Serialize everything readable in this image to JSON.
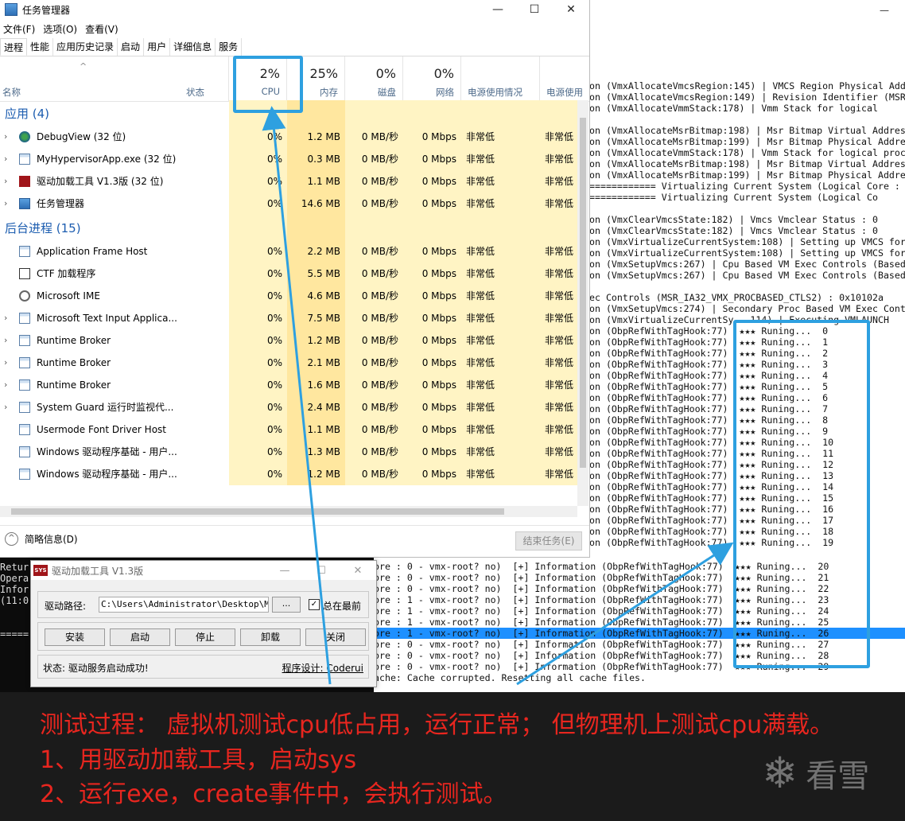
{
  "debug_window": {
    "controls": [
      "—",
      "□",
      "✕"
    ],
    "lines": [
      {
        "text": "on (VmxAllocateVmcsRegion:145) | VMCS Region Physical Add",
        "selected": false
      },
      {
        "text": "on (VmxAllocateVmcsRegion:149) | Revision Identifier (MSR",
        "selected": false
      },
      {
        "text": "on (VmxAllocateVmmStack:178) | Vmm Stack for logical",
        "selected": false
      },
      {
        "text": "",
        "selected": false
      },
      {
        "text": "on (VmxAllocateMsrBitmap:198) | Msr Bitmap Virtual Addres",
        "selected": false
      },
      {
        "text": "on (VmxAllocateMsrBitmap:199) | Msr Bitmap Physical Addre",
        "selected": false
      },
      {
        "text": "on (VmxAllocateVmmStack:178) | Vmm Stack for logical proc",
        "selected": false
      },
      {
        "text": "on (VmxAllocateMsrBitmap:198) | Msr Bitmap Virtual Addres",
        "selected": false
      },
      {
        "text": "on (VmxAllocateMsrBitmap:199) | Msr Bitmap Physical Addre",
        "selected": false
      },
      {
        "text": "============ Virtualizing Current System (Logical Core : 0",
        "selected": false
      },
      {
        "text": "============ Virtualizing Current System (Logical Co",
        "selected": false
      },
      {
        "text": "",
        "selected": false
      },
      {
        "text": "on (VmxClearVmcsState:182) | Vmcs Vmclear Status : 0",
        "selected": false
      },
      {
        "text": "on (VmxClearVmcsState:182) | Vmcs Vmclear Status : 0",
        "selected": false
      },
      {
        "text": "on (VmxVirtualizeCurrentSystem:108) | Setting up VMCS for",
        "selected": false
      },
      {
        "text": "on (VmxVirtualizeCurrentSystem:108) | Setting up VMCS for",
        "selected": false
      },
      {
        "text": "on (VmxSetupVmcs:267) | Cpu Based VM Exec Controls (Based",
        "selected": false
      },
      {
        "text": "on (VmxSetupVmcs:267) | Cpu Based VM Exec Controls (Based",
        "selected": false
      },
      {
        "text": "",
        "selected": false
      },
      {
        "text": "ec Controls (MSR_IA32_VMX_PROCBASED_CTLS2) : 0x10102a",
        "selected": false
      },
      {
        "text": "on (VmxSetupVmcs:274) | Secondary Proc Based VM Exec Cont",
        "selected": false
      },
      {
        "text": "on (VmxVirtualizeCurrentSy...114) | Executing VMLAUNCH",
        "selected": false
      },
      {
        "text": "on (ObpRefWithTagHook:77)  ★★★ Runing...  0",
        "selected": false
      },
      {
        "text": "on (ObpRefWithTagHook:77)  ★★★ Runing...  1",
        "selected": false
      },
      {
        "text": "on (ObpRefWithTagHook:77)  ★★★ Runing...  2",
        "selected": false
      },
      {
        "text": "on (ObpRefWithTagHook:77)  ★★★ Runing...  3",
        "selected": false
      },
      {
        "text": "on (ObpRefWithTagHook:77)  ★★★ Runing...  4",
        "selected": false
      },
      {
        "text": "on (ObpRefWithTagHook:77)  ★★★ Runing...  5",
        "selected": false
      },
      {
        "text": "on (ObpRefWithTagHook:77)  ★★★ Runing...  6",
        "selected": false
      },
      {
        "text": "on (ObpRefWithTagHook:77)  ★★★ Runing...  7",
        "selected": false
      },
      {
        "text": "on (ObpRefWithTagHook:77)  ★★★ Runing...  8",
        "selected": false
      },
      {
        "text": "on (ObpRefWithTagHook:77)  ★★★ Runing...  9",
        "selected": false
      },
      {
        "text": "on (ObpRefWithTagHook:77)  ★★★ Runing...  10",
        "selected": false
      },
      {
        "text": "on (ObpRefWithTagHook:77)  ★★★ Runing...  11",
        "selected": false
      },
      {
        "text": "on (ObpRefWithTagHook:77)  ★★★ Runing...  12",
        "selected": false
      },
      {
        "text": "on (ObpRefWithTagHook:77)  ★★★ Runing...  13",
        "selected": false
      },
      {
        "text": "on (ObpRefWithTagHook:77)  ★★★ Runing...  14",
        "selected": false
      },
      {
        "text": "on (ObpRefWithTagHook:77)  ★★★ Runing...  15",
        "selected": false
      },
      {
        "text": "on (ObpRefWithTagHook:77)  ★★★ Runing...  16",
        "selected": false
      },
      {
        "text": "on (ObpRefWithTagHook:77)  ★★★ Runing...  17",
        "selected": false
      },
      {
        "text": "on (ObpRefWithTagHook:77)  ★★★ Runing...  18",
        "selected": false
      },
      {
        "text": "on (ObpRefWithTagHook:77)  ★★★ Runing...  19",
        "selected": false
      }
    ]
  },
  "console": {
    "left_lines": [
      "Retur",
      "Opera",
      "Infor",
      "(11:0",
      "",
      "",
      "====="
    ],
    "right_lines": [
      {
        "text": "ore : 0 - vmx-root? no)  [+] Information (ObpRefWithTagHook:77)  ★★★ Runing...  20",
        "selected": false
      },
      {
        "text": "ore : 0 - vmx-root? no)  [+] Information (ObpRefWithTagHook:77)  ★★★ Runing...  21",
        "selected": false
      },
      {
        "text": "ore : 0 - vmx-root? no)  [+] Information (ObpRefWithTagHook:77)  ★★★ Runing...  22",
        "selected": false
      },
      {
        "text": "ore : 1 - vmx-root? no)  [+] Information (ObpRefWithTagHook:77)  ★★★ Runing...  23",
        "selected": false
      },
      {
        "text": "ore : 1 - vmx-root? no)  [+] Information (ObpRefWithTagHook:77)  ★★★ Runing...  24",
        "selected": false
      },
      {
        "text": "ore : 1 - vmx-root? no)  [+] Information (ObpRefWithTagHook:77)  ★★★ Runing...  25",
        "selected": false
      },
      {
        "text": "ore : 1 - vmx-root? no)  [+] Information (ObpRefWithTagHook:77)  ★★★ Runing...  26",
        "selected": true
      },
      {
        "text": "ore : 0 - vmx-root? no)  [+] Information (ObpRefWithTagHook:77)  ★★★ Runing...  27",
        "selected": false
      },
      {
        "text": "ore : 0 - vmx-root? no)  [+] Information (ObpRefWithTagHook:77)  ★★★ Runing...  28",
        "selected": false
      },
      {
        "text": "ore : 0 - vmx-root? no)  [+] Information (ObpRefWithTagHook:77)  ★★★ Runing...  29",
        "selected": false
      },
      {
        "text": "ache: Cache corrupted. Resetting all cache files.",
        "selected": false
      }
    ]
  },
  "taskmgr": {
    "title": "任务管理器",
    "menu": [
      "文件(F)",
      "选项(O)",
      "查看(V)"
    ],
    "tabs": [
      "进程",
      "性能",
      "应用历史记录",
      "启动",
      "用户",
      "详细信息",
      "服务"
    ],
    "active_tab": "进程",
    "columns": {
      "name": "名称",
      "status": "状态",
      "cpu": {
        "pct": "2%",
        "label": "CPU"
      },
      "mem": {
        "pct": "25%",
        "label": "内存"
      },
      "disk": {
        "pct": "0%",
        "label": "磁盘"
      },
      "net": {
        "pct": "0%",
        "label": "网络"
      },
      "power": "电源使用情况",
      "power_trend": "电源使用"
    },
    "groups": [
      {
        "title": "应用 (4)",
        "rows": [
          {
            "name": "DebugView (32 位)",
            "cpu": "0%",
            "mem": "1.2 MB",
            "disk": "0 MB/秒",
            "net": "0 Mbps",
            "power": "非常低",
            "pt": "非常低",
            "expand": true,
            "icon": "debugview-icon"
          },
          {
            "name": "MyHypervisorApp.exe (32 位)",
            "cpu": "0%",
            "mem": "0.3 MB",
            "disk": "0 MB/秒",
            "net": "0 Mbps",
            "power": "非常低",
            "pt": "非常低",
            "expand": true,
            "icon": "app-window-icon"
          },
          {
            "name": "驱动加载工具 V1.3版 (32 位)",
            "cpu": "0%",
            "mem": "1.1 MB",
            "disk": "0 MB/秒",
            "net": "0 Mbps",
            "power": "非常低",
            "pt": "非常低",
            "expand": true,
            "icon": "sys-icon"
          },
          {
            "name": "任务管理器",
            "cpu": "0%",
            "mem": "14.6 MB",
            "disk": "0 MB/秒",
            "net": "0 Mbps",
            "power": "非常低",
            "pt": "非常低",
            "expand": true,
            "icon": "taskmgr-icon"
          }
        ]
      },
      {
        "title": "后台进程 (15)",
        "rows": [
          {
            "name": "Application Frame Host",
            "cpu": "0%",
            "mem": "2.2 MB",
            "disk": "0 MB/秒",
            "net": "0 Mbps",
            "power": "非常低",
            "pt": "非常低",
            "expand": false,
            "icon": "app-window-icon"
          },
          {
            "name": "CTF 加载程序",
            "cpu": "0%",
            "mem": "5.5 MB",
            "disk": "0 MB/秒",
            "net": "0 Mbps",
            "power": "非常低",
            "pt": "非常低",
            "expand": false,
            "icon": "ctf-icon"
          },
          {
            "name": "Microsoft IME",
            "cpu": "0%",
            "mem": "4.6 MB",
            "disk": "0 MB/秒",
            "net": "0 Mbps",
            "power": "非常低",
            "pt": "非常低",
            "expand": false,
            "icon": "gear-icon"
          },
          {
            "name": "Microsoft Text Input Applica...",
            "cpu": "0%",
            "mem": "7.5 MB",
            "disk": "0 MB/秒",
            "net": "0 Mbps",
            "power": "非常低",
            "pt": "非常低",
            "expand": true,
            "icon": "app-window-icon"
          },
          {
            "name": "Runtime Broker",
            "cpu": "0%",
            "mem": "1.2 MB",
            "disk": "0 MB/秒",
            "net": "0 Mbps",
            "power": "非常低",
            "pt": "非常低",
            "expand": true,
            "icon": "app-window-icon"
          },
          {
            "name": "Runtime Broker",
            "cpu": "0%",
            "mem": "2.1 MB",
            "disk": "0 MB/秒",
            "net": "0 Mbps",
            "power": "非常低",
            "pt": "非常低",
            "expand": true,
            "icon": "app-window-icon"
          },
          {
            "name": "Runtime Broker",
            "cpu": "0%",
            "mem": "1.6 MB",
            "disk": "0 MB/秒",
            "net": "0 Mbps",
            "power": "非常低",
            "pt": "非常低",
            "expand": true,
            "icon": "app-window-icon"
          },
          {
            "name": "System Guard 运行时监视代...",
            "cpu": "0%",
            "mem": "2.4 MB",
            "disk": "0 MB/秒",
            "net": "0 Mbps",
            "power": "非常低",
            "pt": "非常低",
            "expand": true,
            "icon": "app-window-icon"
          },
          {
            "name": "Usermode Font Driver Host",
            "cpu": "0%",
            "mem": "1.1 MB",
            "disk": "0 MB/秒",
            "net": "0 Mbps",
            "power": "非常低",
            "pt": "非常低",
            "expand": false,
            "icon": "app-window-icon"
          },
          {
            "name": "Windows 驱动程序基础 - 用户...",
            "cpu": "0%",
            "mem": "1.3 MB",
            "disk": "0 MB/秒",
            "net": "0 Mbps",
            "power": "非常低",
            "pt": "非常低",
            "expand": false,
            "icon": "app-window-icon"
          },
          {
            "name": "Windows 驱动程序基础 - 用户...",
            "cpu": "0%",
            "mem": "1.2 MB",
            "disk": "0 MB/秒",
            "net": "0 Mbps",
            "power": "非常低",
            "pt": "非常低",
            "expand": false,
            "icon": "app-window-icon"
          }
        ]
      }
    ],
    "footer": {
      "fewer_details": "简略信息(D)",
      "end_task": "结束任务(E)"
    }
  },
  "driver_tool": {
    "title": "驱动加载工具 V1.3版",
    "path_label": "驱动路径:",
    "path_value": "C:\\Users\\Administrator\\Desktop\\MyH",
    "browse": "...",
    "topmost_checked": true,
    "topmost_label": "总在最前",
    "buttons": [
      "安装",
      "启动",
      "停止",
      "卸载",
      "关闭"
    ],
    "status": "状态: 驱动服务启动成功!",
    "author": "程序设计: Coderui"
  },
  "annotation": {
    "lines": [
      "测试过程： 虚拟机测试cpu低占用，运行正常；  但物理机上测试cpu满载。",
      "1、用驱动加载工具，启动sys",
      "2、运行exe，create事件中，会执行测试。"
    ],
    "color": "#e8261f",
    "logo_text": "看雪",
    "logo_icon": "snowflake-icon"
  },
  "highlight_color": "#2ea0e0"
}
